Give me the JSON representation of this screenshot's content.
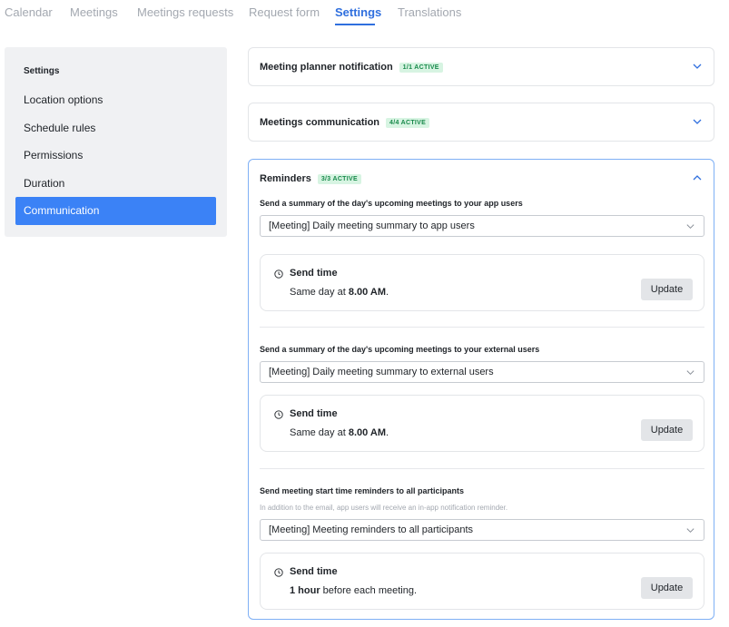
{
  "tabs": [
    {
      "label": "Calendar"
    },
    {
      "label": "Meetings"
    },
    {
      "label": "Meetings requests"
    },
    {
      "label": "Request form"
    },
    {
      "label": "Settings"
    },
    {
      "label": "Translations"
    }
  ],
  "active_tab": "Settings",
  "sidebar": {
    "title": "Settings",
    "items": [
      {
        "label": "Location options"
      },
      {
        "label": "Schedule rules"
      },
      {
        "label": "Permissions"
      },
      {
        "label": "Duration"
      },
      {
        "label": "Communication"
      }
    ],
    "active_item": "Communication"
  },
  "cards": {
    "planner": {
      "title": "Meeting planner notification",
      "badge": "1/1 ACTIVE"
    },
    "communication": {
      "title": "Meetings communication",
      "badge": "4/4 ACTIVE"
    },
    "reminders": {
      "title": "Reminders",
      "badge": "3/3 ACTIVE",
      "sections": [
        {
          "label": "Send a summary of the day's upcoming meetings to your app users",
          "select_value": "[Meeting] Daily meeting summary to app users",
          "send_title": "Send time",
          "desc_prefix": "Same day at ",
          "desc_bold": "8.00 AM",
          "desc_suffix": ".",
          "button": "Update"
        },
        {
          "label": "Send a summary of the day's upcoming meetings to your external users",
          "select_value": "[Meeting] Daily meeting summary to external users",
          "send_title": "Send time",
          "desc_prefix": "Same day at ",
          "desc_bold": "8.00 AM",
          "desc_suffix": ".",
          "button": "Update"
        },
        {
          "label": "Send meeting start time reminders to all participants",
          "note": "In addition to the email, app users will receive an in-app notification reminder.",
          "select_value": "[Meeting] Meeting reminders to all participants",
          "send_title": "Send time",
          "desc_prefix": "",
          "desc_bold": "1 hour",
          "desc_suffix": " before each meeting.",
          "button": "Update"
        }
      ]
    }
  },
  "colors": {
    "accent": "#2f6fde",
    "sidebar_active": "#3b82f6",
    "badge_text": "#17894a",
    "badge_bg": "#d7f4e2"
  }
}
